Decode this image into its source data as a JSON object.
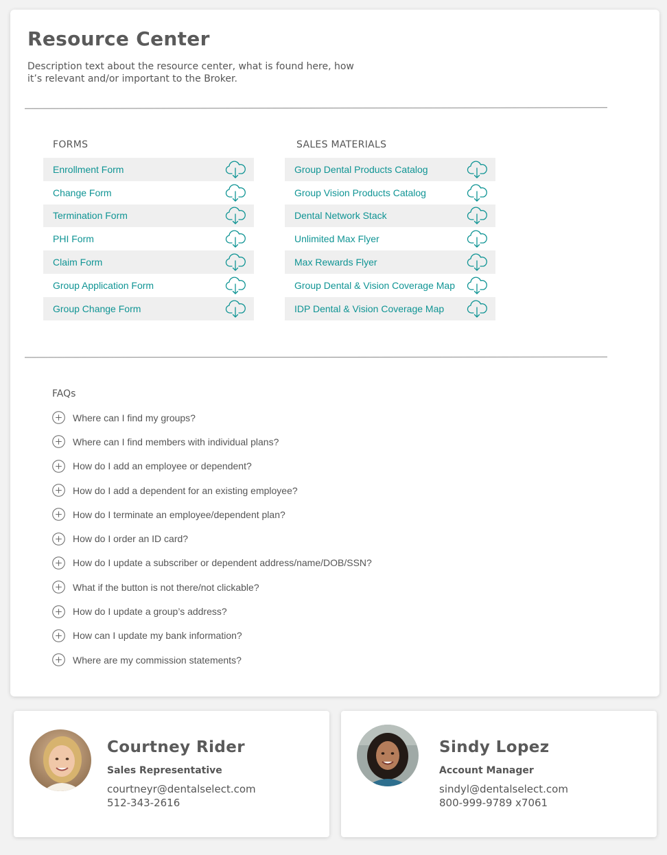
{
  "page": {
    "title": "Resource Center",
    "description": "Description text about the resource center, what is found here, how it’s relevant and/or important to the Broker."
  },
  "forms": {
    "heading": "FORMS",
    "items": [
      {
        "label": "Enrollment Form"
      },
      {
        "label": "Change Form"
      },
      {
        "label": "Termination Form"
      },
      {
        "label": "PHI Form"
      },
      {
        "label": "Claim Form"
      },
      {
        "label": "Group Application Form"
      },
      {
        "label": "Group Change Form"
      }
    ]
  },
  "sales": {
    "heading": "SALES MATERIALS",
    "items": [
      {
        "label": "Group Dental Products Catalog"
      },
      {
        "label": "Group Vision Products Catalog"
      },
      {
        "label": "Dental Network Stack"
      },
      {
        "label": "Unlimited Max Flyer"
      },
      {
        "label": "Max Rewards Flyer"
      },
      {
        "label": "Group Dental & Vision Coverage Map"
      },
      {
        "label": "IDP Dental & Vision Coverage Map"
      }
    ]
  },
  "faqs": {
    "heading": "FAQs",
    "items": [
      "Where can I find my groups?",
      "Where can I find members with individual plans?",
      "How do I add an employee or dependent?",
      "How do I add a dependent for an existing employee?",
      "How do I terminate an employee/dependent plan?",
      "How do I order an ID card?",
      "How do I update a subscriber or dependent address/name/DOB/SSN?",
      "What if the button is not there/not clickable?",
      "How do I update a group’s address?",
      "How can I update my bank information?",
      "Where are my commission statements?"
    ]
  },
  "contacts": [
    {
      "name": "Courtney Rider",
      "role": "Sales Representative",
      "email": "courtneyr@dentalselect.com",
      "phone": "512-343-2616"
    },
    {
      "name": "Sindy Lopez",
      "role": "Account Manager",
      "email": "sindyl@dentalselect.com",
      "phone": "800-999-9789 x7061"
    }
  ],
  "colors": {
    "accent": "#0f9494",
    "row_shade": "#efefef",
    "text": "#555555"
  },
  "icons": {
    "download": "cloud-download-icon",
    "faq_expand": "plus-circle-icon"
  }
}
